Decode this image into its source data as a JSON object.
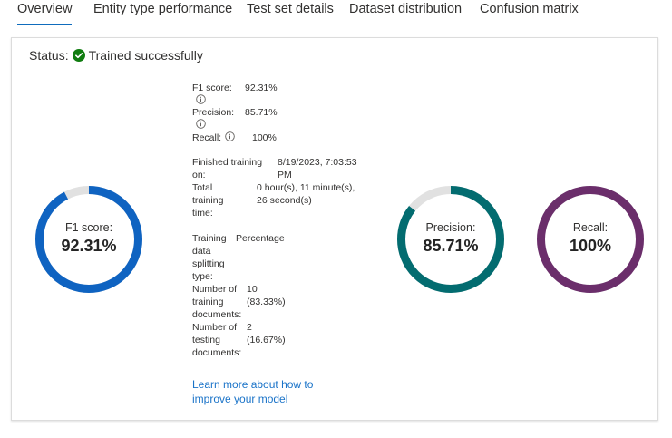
{
  "tabs": [
    {
      "label": "Overview",
      "active": true
    },
    {
      "label": "Entity type performance",
      "active": false
    },
    {
      "label": "Test set details",
      "active": false
    },
    {
      "label": "Dataset distribution",
      "active": false
    },
    {
      "label": "Confusion matrix",
      "active": false
    }
  ],
  "status": {
    "label": "Status:",
    "value": "Trained successfully",
    "color": "#107c10"
  },
  "scores": {
    "f1": {
      "label": "F1 score:",
      "value": "92.31%"
    },
    "precision": {
      "label": "Precision:",
      "value": "85.71%"
    },
    "recall": {
      "label": "Recall:",
      "value": "100%"
    }
  },
  "details": {
    "finished_label": "Finished training on:",
    "finished_value": "8/19/2023, 7:03:53 PM",
    "total_time_label": "Total training time:",
    "total_time_value": "0 hour(s), 11 minute(s), 26 second(s)",
    "split_label": "Training data splitting type:",
    "split_value": "Percentage",
    "train_docs_label": "Number of training documents:",
    "train_docs_value": "10 (83.33%)",
    "test_docs_label": "Number of testing documents:",
    "test_docs_value": "2 (16.67%)"
  },
  "learn_more": "Learn more about how to improve your model",
  "rings": [
    {
      "id": "f1",
      "label": "F1 score:",
      "value": "92.31%",
      "fraction": 0.9231,
      "color": "#0f63c1"
    },
    {
      "id": "precision",
      "label": "Precision:",
      "value": "85.71%",
      "fraction": 0.8571,
      "color": "#036c70"
    },
    {
      "id": "recall",
      "label": "Recall:",
      "value": "100%",
      "fraction": 1.0,
      "color": "#6b2e6b"
    }
  ],
  "colors": {
    "accent": "#0f6cbd",
    "track": "#e1e1e1",
    "link": "#1a73c8"
  }
}
